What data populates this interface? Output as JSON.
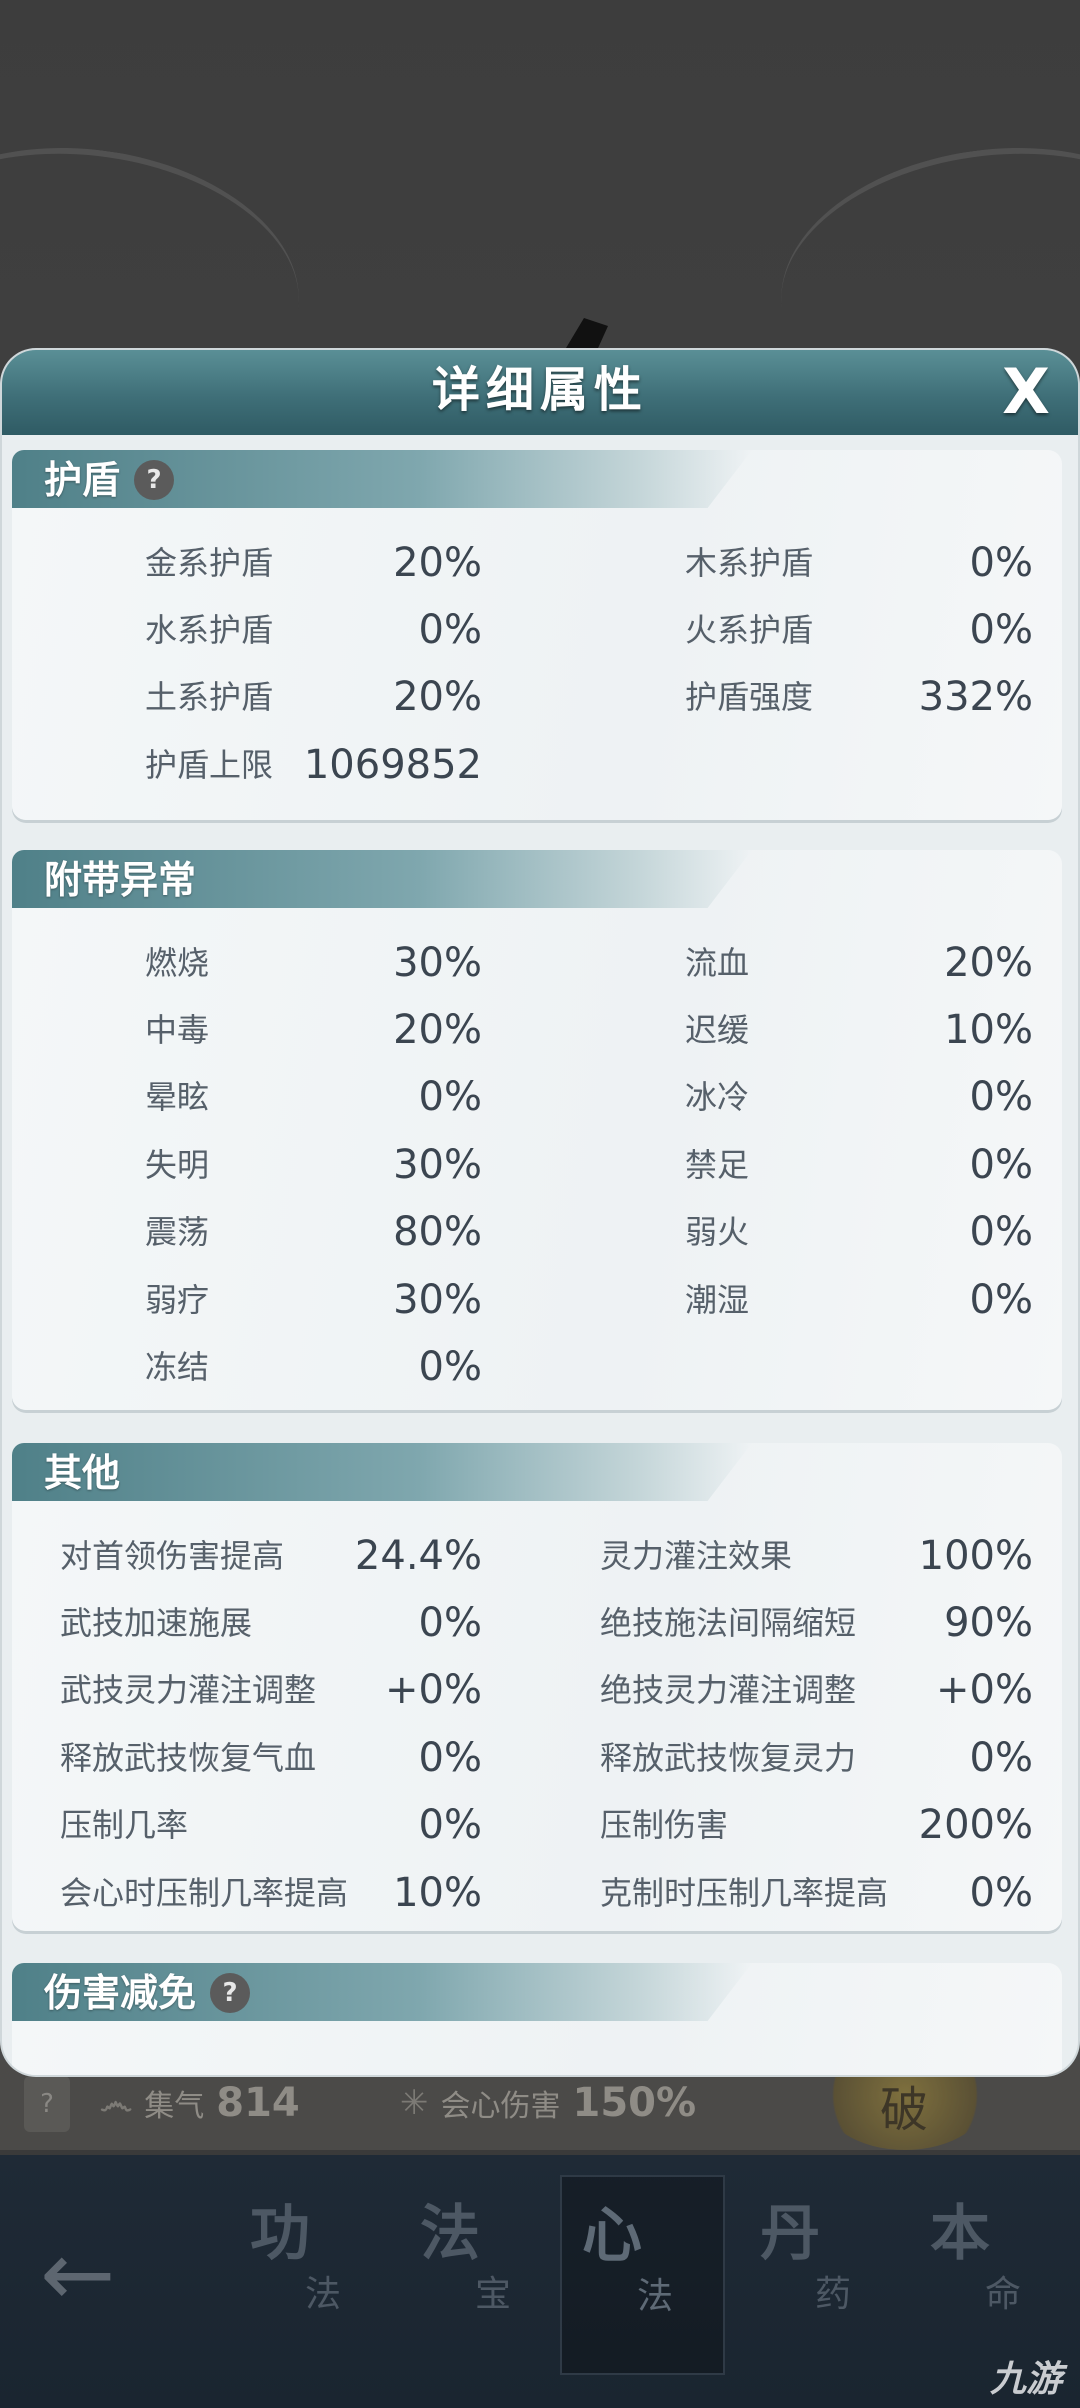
{
  "modal": {
    "title": "详细属性",
    "close_label": "X"
  },
  "sections": {
    "shield": {
      "title": "护盾",
      "help": "?",
      "stats": [
        {
          "label": "金系护盾",
          "value": "20%"
        },
        {
          "label": "木系护盾",
          "value": "0%"
        },
        {
          "label": "水系护盾",
          "value": "0%"
        },
        {
          "label": "火系护盾",
          "value": "0%"
        },
        {
          "label": "土系护盾",
          "value": "20%"
        },
        {
          "label": "护盾强度",
          "value": "332%"
        },
        {
          "label": "护盾上限",
          "value": "1069852"
        }
      ]
    },
    "status": {
      "title": "附带异常",
      "stats": [
        {
          "label": "燃烧",
          "value": "30%"
        },
        {
          "label": "流血",
          "value": "20%"
        },
        {
          "label": "中毒",
          "value": "20%"
        },
        {
          "label": "迟缓",
          "value": "10%"
        },
        {
          "label": "晕眩",
          "value": "0%"
        },
        {
          "label": "冰冷",
          "value": "0%"
        },
        {
          "label": "失明",
          "value": "30%"
        },
        {
          "label": "禁足",
          "value": "0%"
        },
        {
          "label": "震荡",
          "value": "80%"
        },
        {
          "label": "弱火",
          "value": "0%"
        },
        {
          "label": "弱疗",
          "value": "30%"
        },
        {
          "label": "潮湿",
          "value": "0%"
        },
        {
          "label": "冻结",
          "value": "0%"
        }
      ]
    },
    "other": {
      "title": "其他",
      "stats": [
        {
          "label": "对首领伤害提高",
          "value": "24.4%"
        },
        {
          "label": "灵力灌注效果",
          "value": "100%"
        },
        {
          "label": "武技加速施展",
          "value": "0%"
        },
        {
          "label": "绝技施法间隔缩短",
          "value": "90%"
        },
        {
          "label": "武技灵力灌注调整",
          "value": "+0%"
        },
        {
          "label": "绝技灵力灌注调整",
          "value": "+0%"
        },
        {
          "label": "释放武技恢复气血",
          "value": "0%"
        },
        {
          "label": "释放武技恢复灵力",
          "value": "0%"
        },
        {
          "label": "压制几率",
          "value": "0%"
        },
        {
          "label": "压制伤害",
          "value": "200%"
        },
        {
          "label": "会心时压制几率提高",
          "value": "10%"
        },
        {
          "label": "克制时压制几率提高",
          "value": "0%"
        }
      ]
    },
    "damage_reduction": {
      "title": "伤害减免",
      "help": "?"
    }
  },
  "background": {
    "help": "?",
    "stat_charge": {
      "label": "集气",
      "value": "814"
    },
    "stat_crit": {
      "label": "会心伤害",
      "value": "150%"
    },
    "emblem_text": "破",
    "nav": [
      {
        "big": "功",
        "small": "法"
      },
      {
        "big": "法",
        "small": "宝"
      },
      {
        "big": "心",
        "small": "法"
      },
      {
        "big": "丹",
        "small": "药"
      },
      {
        "big": "本",
        "small": "命"
      }
    ],
    "back_icon": "←",
    "watermark": "九游"
  }
}
